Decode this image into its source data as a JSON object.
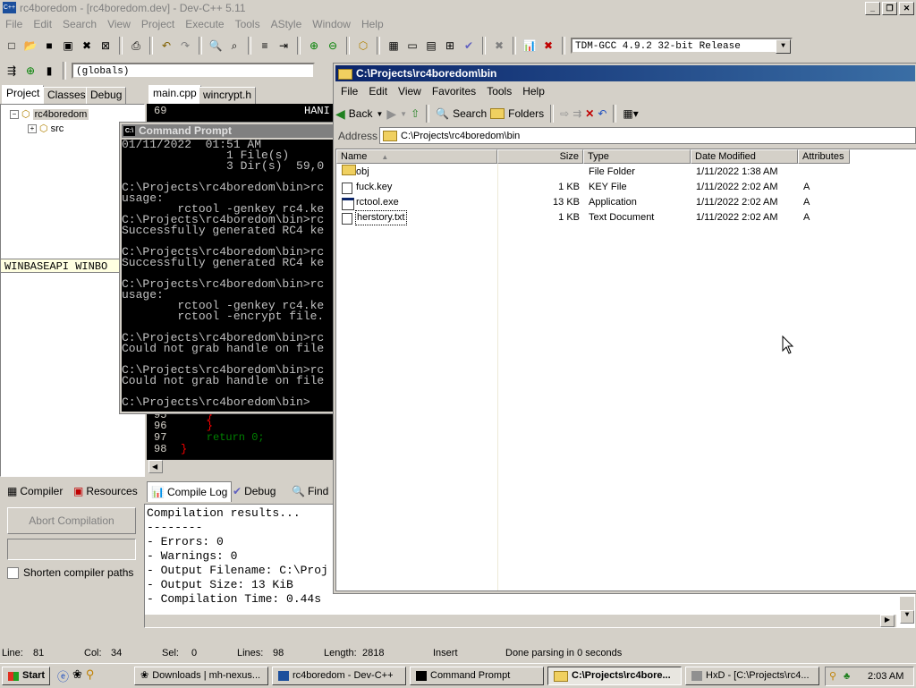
{
  "devcpp": {
    "title": "rc4boredom - [rc4boredom.dev] - Dev-C++ 5.11",
    "menu": [
      "File",
      "Edit",
      "Search",
      "View",
      "Project",
      "Execute",
      "Tools",
      "AStyle",
      "Window",
      "Help"
    ],
    "compiler_select": "TDM-GCC 4.9.2 32-bit Release",
    "globals_select": "(globals)",
    "left_tabs": [
      "Project",
      "Classes",
      "Debug"
    ],
    "editor_tabs": [
      "main.cpp",
      "wincrypt.h"
    ],
    "tree": {
      "root": "rc4boredom",
      "child": "src"
    },
    "tooltip": "WINBASEAPI WINBO",
    "editor_lines": [
      {
        "num": "69",
        "text": "HANI",
        "color": "#ffffff"
      },
      {
        "num": "95",
        "text": "    }",
        "color": "#ff0000"
      },
      {
        "num": "96",
        "text": "    }",
        "color": "#ff0000"
      },
      {
        "num": "97",
        "text": "    return 0;",
        "color": "#008000"
      },
      {
        "num": "98",
        "text": "}",
        "color": "#ff0000"
      }
    ],
    "bottom_tabs": [
      "Compiler",
      "Resources",
      "Compile Log",
      "Debug",
      "Find"
    ],
    "abort_button": "Abort Compilation",
    "shorten_label": "Shorten compiler paths",
    "log_lines": [
      "Compilation results...",
      "--------",
      "- Errors: 0",
      "- Warnings: 0",
      "- Output Filename: C:\\Proj",
      "- Output Size: 13 KiB",
      "- Compilation Time: 0.44s"
    ],
    "status": {
      "line_label": "Line:",
      "line": "81",
      "col_label": "Col:",
      "col": "34",
      "sel_label": "Sel:",
      "sel": "0",
      "lines_label": "Lines:",
      "lines": "98",
      "length_label": "Length:",
      "length": "2818",
      "mode": "Insert",
      "message": "Done parsing in 0 seconds"
    }
  },
  "cmd": {
    "title": "Command Prompt",
    "lines": [
      "01/11/2022  01:51 AM",
      "               1 File(s)",
      "               3 Dir(s)  59,0",
      "",
      "C:\\Projects\\rc4boredom\\bin>rc",
      "usage:",
      "        rctool -genkey rc4.ke",
      "C:\\Projects\\rc4boredom\\bin>rc",
      "Successfully generated RC4 ke",
      "",
      "C:\\Projects\\rc4boredom\\bin>rc",
      "Successfully generated RC4 ke",
      "",
      "C:\\Projects\\rc4boredom\\bin>rc",
      "usage:",
      "        rctool -genkey rc4.ke",
      "        rctool -encrypt file.",
      "",
      "C:\\Projects\\rc4boredom\\bin>rc",
      "Could not grab handle on file",
      "",
      "C:\\Projects\\rc4boredom\\bin>rc",
      "Could not grab handle on file",
      "",
      "C:\\Projects\\rc4boredom\\bin>"
    ]
  },
  "explorer": {
    "title": "C:\\Projects\\rc4boredom\\bin",
    "menu": [
      "File",
      "Edit",
      "View",
      "Favorites",
      "Tools",
      "Help"
    ],
    "back": "Back",
    "search": "Search",
    "folders": "Folders",
    "address_label": "Address",
    "address": "C:\\Projects\\rc4boredom\\bin",
    "columns": [
      "Name",
      "Size",
      "Type",
      "Date Modified",
      "Attributes"
    ],
    "files": [
      {
        "name": "obj",
        "size": "",
        "type": "File Folder",
        "date": "1/11/2022 1:38 AM",
        "attr": "",
        "icon": "folder-icon"
      },
      {
        "name": "fuck.key",
        "size": "1 KB",
        "type": "KEY File",
        "date": "1/11/2022 2:02 AM",
        "attr": "A",
        "icon": "file-icon"
      },
      {
        "name": "rctool.exe",
        "size": "13 KB",
        "type": "Application",
        "date": "1/11/2022 2:02 AM",
        "attr": "A",
        "icon": "exe-icon"
      },
      {
        "name": "herstory.txt",
        "size": "1 KB",
        "type": "Text Document",
        "date": "1/11/2022 2:02 AM",
        "attr": "A",
        "icon": "text-file-icon"
      }
    ]
  },
  "taskbar": {
    "start": "Start",
    "tasks": [
      {
        "label": "Downloads | mh-nexus..."
      },
      {
        "label": "rc4boredom - Dev-C++"
      },
      {
        "label": "Command Prompt"
      },
      {
        "label": "C:\\Projects\\rc4bore..."
      },
      {
        "label": "HxD - [C:\\Projects\\rc4..."
      }
    ],
    "clock": "2:03 AM"
  }
}
